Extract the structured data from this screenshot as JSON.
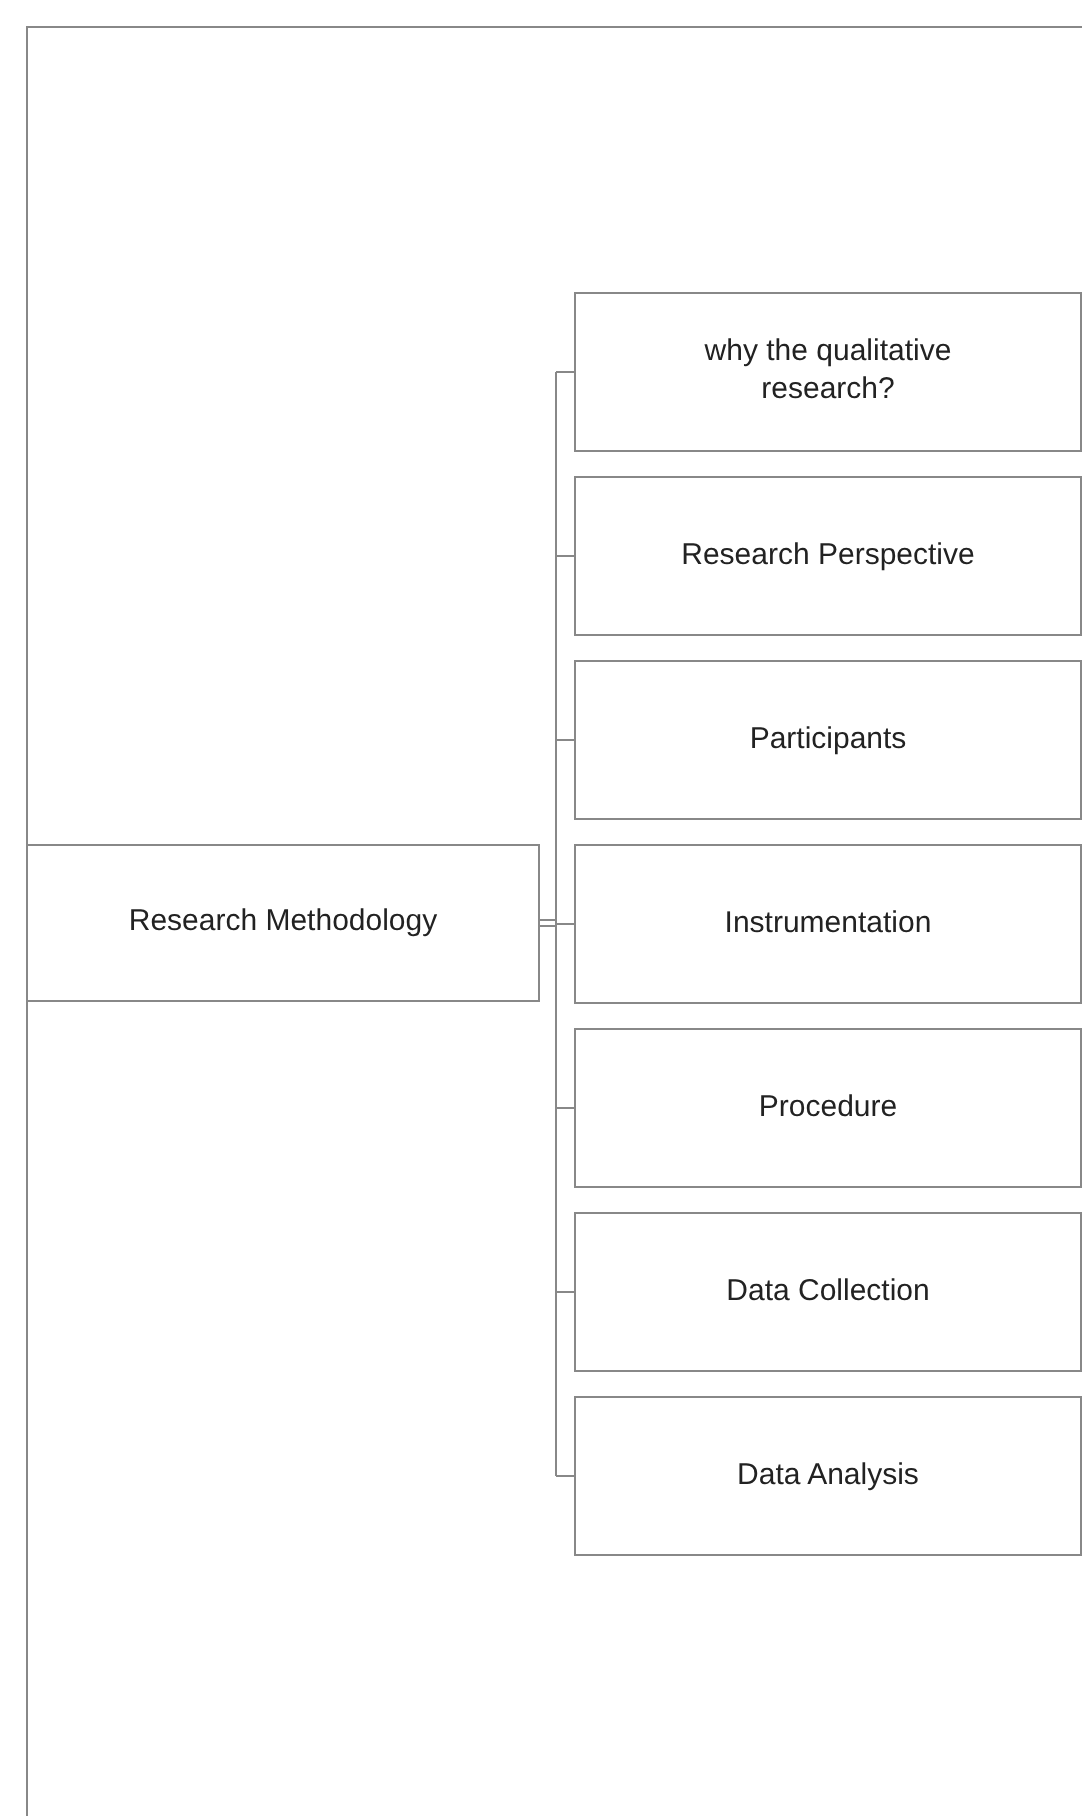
{
  "diagram": {
    "root": {
      "label": "Research Methodology",
      "children": [
        {
          "label": "why the qualitative research?"
        },
        {
          "label": "Research Perspective"
        },
        {
          "label": "Participants"
        },
        {
          "label": "Instrumentation"
        },
        {
          "label": "Procedure"
        },
        {
          "label": "Data Collection"
        },
        {
          "label": "Data Analysis"
        }
      ]
    }
  }
}
